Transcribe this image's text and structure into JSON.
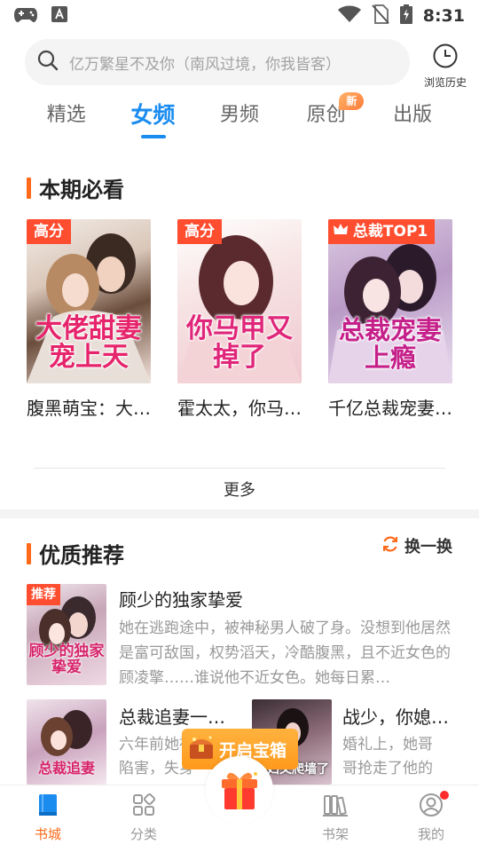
{
  "status_bar": {
    "time": "8:31",
    "icons": [
      "gamepad-icon",
      "app-a-icon",
      "wifi-icon",
      "no-sim-icon",
      "battery-charging-icon"
    ]
  },
  "search": {
    "placeholder": "亿万繁星不及你（南风过境，你我皆客）",
    "history_label": "浏览历史"
  },
  "tabs": [
    {
      "label": "精选",
      "active": false
    },
    {
      "label": "女频",
      "active": true
    },
    {
      "label": "男频",
      "active": false
    },
    {
      "label": "原创",
      "active": false,
      "badge": "新"
    },
    {
      "label": "出版",
      "active": false
    }
  ],
  "must_read": {
    "title": "本期必看",
    "books": [
      {
        "tag": "高分",
        "cover_title": "大佬甜妻宠上天",
        "name": "腹黑萌宝：大…"
      },
      {
        "tag": "高分",
        "cover_title": "你马甲又掉了",
        "name": "霍太太，你马…"
      },
      {
        "tag": "总裁TOP1",
        "cover_title": "总裁宠妻上瘾",
        "name": "千亿总裁宠妻…"
      }
    ],
    "more_label": "更多"
  },
  "quality": {
    "title": "优质推荐",
    "refresh_label": "换一换",
    "featured": {
      "tag": "推荐",
      "cover_title": "顾少的独家挚爱",
      "title": "顾少的独家挚爱",
      "desc": "她在逃跑途中，被神秘男人破了身。没想到他居然是富可敌国，权势滔天，冷酷腹黑，且不近女色的顾凌擎……谁说他不近女色。她每日累…"
    },
    "items": [
      {
        "title": "总裁追妻一…",
        "desc": "六年前她被母陷害，失身",
        "cover_title": "总裁追妻"
      },
      {
        "title": "战少，你媳…",
        "desc": "婚礼上，她哥哥抢走了他的",
        "cover_title": "媳妇又爬墙了"
      }
    ]
  },
  "chest": {
    "label": "开启宝箱"
  },
  "nav": [
    {
      "label": "书城",
      "icon": "book-icon",
      "active": true
    },
    {
      "label": "分类",
      "icon": "category-icon",
      "active": false
    },
    {
      "label": "书架",
      "icon": "bookshelf-icon",
      "active": false
    },
    {
      "label": "我的",
      "icon": "profile-icon",
      "active": false,
      "has_dot": true
    }
  ],
  "colors": {
    "accent_blue": "#1a8cf0",
    "accent_orange": "#ff6a1a",
    "tag_red": "#ff4d30"
  }
}
